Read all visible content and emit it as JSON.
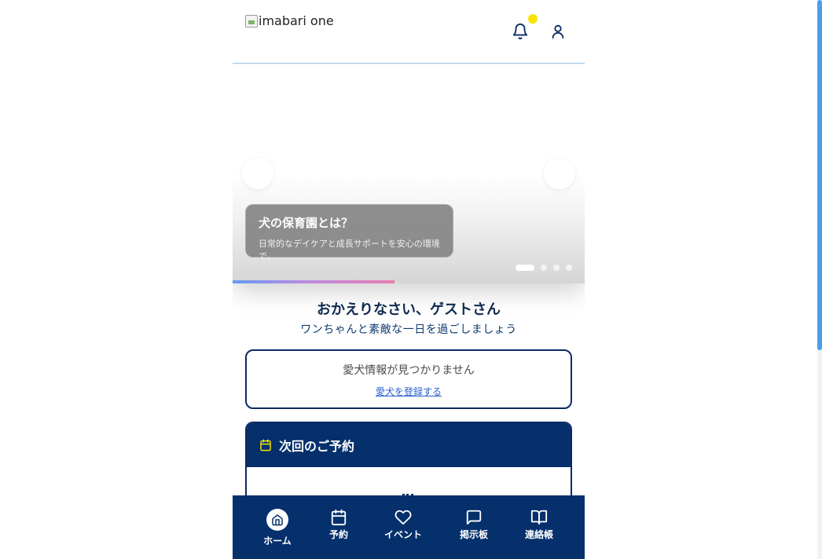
{
  "header": {
    "logo_alt": "imabari one",
    "notification_badge_color": "#f7e300"
  },
  "carousel": {
    "slide_title": "犬の保育園とは？",
    "slide_subtitle": "日常的なデイケアと成長サポートを安心の環境で。",
    "slide_count": 4,
    "active_slide": 1,
    "progress_fraction": 0.46
  },
  "welcome": {
    "title": "おかえりなさい、ゲストさん",
    "subtitle": "ワンちゃんと素敵な一日を過ごしましょう"
  },
  "pet_card": {
    "message": "愛犬情報が見つかりません",
    "register_link": "愛犬を登録する"
  },
  "reservation": {
    "title": "次回のご予約",
    "icon": "calendar-icon",
    "icon_color": "#f7e300"
  },
  "bottom_nav": {
    "items": [
      {
        "label": "ホーム",
        "icon": "home-icon",
        "active": true
      },
      {
        "label": "予約",
        "icon": "calendar-icon",
        "active": false
      },
      {
        "label": "イベント",
        "icon": "heart-icon",
        "active": false
      },
      {
        "label": "掲示板",
        "icon": "chat-icon",
        "active": false
      },
      {
        "label": "連絡帳",
        "icon": "book-icon",
        "active": false
      }
    ]
  },
  "colors": {
    "navy": "#05306c",
    "accent_yellow": "#f7e300",
    "link_blue": "#2a5fd0"
  }
}
